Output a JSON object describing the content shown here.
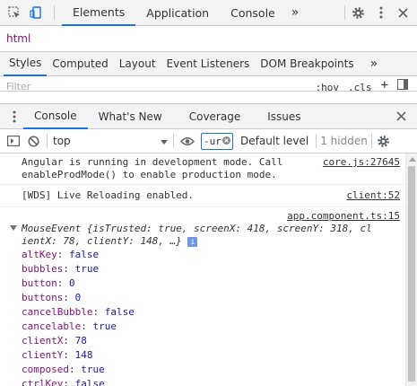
{
  "top_bar": {
    "tabs": [
      "Elements",
      "Application",
      "Console"
    ],
    "more": "»",
    "icons": [
      "inspect-element-icon",
      "device-toolbar-icon",
      "settings-gear-icon",
      "kebab-menu-icon",
      "close-icon"
    ]
  },
  "breadcrumb": {
    "item": "html"
  },
  "styles_tabs": {
    "tabs": [
      "Styles",
      "Computed",
      "Layout",
      "Event Listeners",
      "DOM Breakpoints"
    ],
    "more": "»"
  },
  "filter": {
    "placeholder": "Filter",
    "hov": ":hov",
    "cls": ".cls",
    "add": "+"
  },
  "drawer": {
    "tabs": [
      "Console",
      "What's New",
      "Coverage",
      "Issues"
    ]
  },
  "console_toolbar": {
    "context": "top",
    "filter_value": "-url",
    "levels": "Default level",
    "hidden": "1 hidden"
  },
  "messages": [
    {
      "text": "Angular is running in development mode. Call\nenableProdMode() to enable production mode.",
      "source": "core.js:27645"
    },
    {
      "text": "[WDS] Live Reloading enabled.",
      "source": "client:52"
    }
  ],
  "event_log": {
    "source": "app.component.ts:15",
    "head_line1": "MouseEvent {isTrusted: true, screenX: 418, screenY: 318, cl",
    "head_line2": "ientX: 78, clientY: 148, …}",
    "info": "i",
    "props": [
      {
        "key": "altKey",
        "value": "false"
      },
      {
        "key": "bubbles",
        "value": "true"
      },
      {
        "key": "button",
        "value": "0"
      },
      {
        "key": "buttons",
        "value": "0"
      },
      {
        "key": "cancelBubble",
        "value": "false"
      },
      {
        "key": "cancelable",
        "value": "true"
      },
      {
        "key": "clientX",
        "value": "78"
      },
      {
        "key": "clientY",
        "value": "148"
      },
      {
        "key": "composed",
        "value": "true"
      },
      {
        "key": "ctrlKey",
        "value": "false"
      }
    ]
  },
  "colors": {
    "accent": "#1a73e8",
    "key": "#881280",
    "value": "#1a1aa6"
  }
}
